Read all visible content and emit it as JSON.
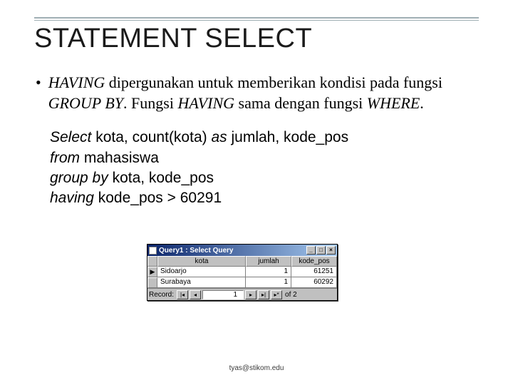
{
  "title": "STATEMENT SELECT",
  "bullet": {
    "p1a": "HAVING",
    "p1b": " dipergunakan untuk memberikan kondisi pada fungsi ",
    "p1c": "GROUP BY",
    "p1d": ". Fungsi ",
    "p1e": "HAVING",
    "p1f": " sama dengan fungsi ",
    "p1g": "WHERE",
    "p1h": "."
  },
  "sql": {
    "l1_select": "Select",
    "l1_rest": " kota, count(kota) ",
    "l1_as": "as",
    "l1_rest2": " jumlah, kode_pos",
    "l2_from": "from",
    "l2_rest": " mahasiswa",
    "l3_group": "group by",
    "l3_rest": " kota, kode_pos",
    "l4_having": "having",
    "l4_rest": " kode_pos > 60291"
  },
  "window": {
    "title": "Query1 : Select Query",
    "btn_min": "_",
    "btn_max": "□",
    "btn_close": "×",
    "headers": [
      "kota",
      "jumlah",
      "kode_pos"
    ],
    "rows": [
      {
        "marker": "▶",
        "kota": "Sidoarjo",
        "jumlah": "1",
        "kode_pos": "61251"
      },
      {
        "marker": "",
        "kota": "Surabaya",
        "jumlah": "1",
        "kode_pos": "60292"
      }
    ],
    "nav": {
      "label": "Record:",
      "first": "|◂",
      "prev": "◂",
      "value": "1",
      "next": "▸",
      "last": "▸|",
      "new": "▸*",
      "of_label": "of ",
      "of_count": "2"
    }
  },
  "footer": "tyas@stikom.edu"
}
